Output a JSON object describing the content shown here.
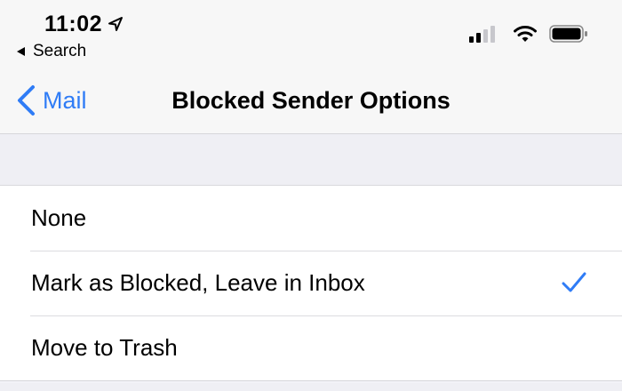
{
  "status_bar": {
    "time": "11:02",
    "back_app_label": "Search",
    "icons": [
      "location-arrow-icon",
      "signal-icon",
      "wifi-icon",
      "battery-icon"
    ]
  },
  "nav": {
    "back_label": "Mail",
    "title": "Blocked Sender Options"
  },
  "options": [
    {
      "label": "None",
      "selected": false
    },
    {
      "label": "Mark as Blocked, Leave in Inbox",
      "selected": true
    },
    {
      "label": "Move to Trash",
      "selected": false
    }
  ],
  "colors": {
    "accent": "#2f7cf6",
    "background": "#efeff4",
    "cell": "#ffffff"
  }
}
